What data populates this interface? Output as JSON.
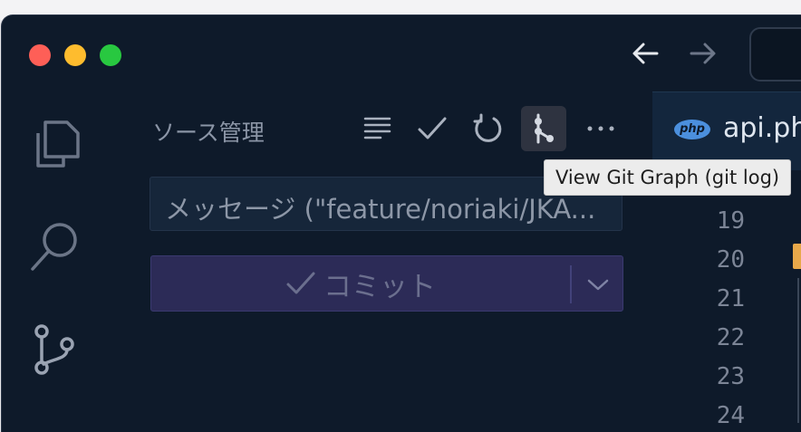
{
  "window": {
    "traffic_lights": [
      "close",
      "minimize",
      "zoom"
    ]
  },
  "nav": {
    "back_icon": "arrow-left-icon",
    "forward_icon": "arrow-right-icon"
  },
  "activity_bar": {
    "items": [
      {
        "name": "explorer",
        "icon": "files-icon"
      },
      {
        "name": "search",
        "icon": "search-icon"
      },
      {
        "name": "source-control",
        "icon": "source-control-icon"
      }
    ]
  },
  "scm": {
    "title": "ソース管理",
    "toolbar_icons": [
      "view-as-tree-icon",
      "commit-check-icon",
      "refresh-icon",
      "git-graph-icon",
      "more-icon"
    ],
    "message_placeholder": "メッセージ (\"feature/noriaki/JKA...",
    "commit_label": "コミット"
  },
  "tooltip": {
    "text": "View Git Graph (git log)"
  },
  "editor": {
    "tab_badge": "php",
    "tab_label": "api.ph",
    "line_numbers": [
      "19",
      "20",
      "21",
      "22",
      "23",
      "24"
    ]
  },
  "colors": {
    "background": "#0e1a2a",
    "commit_button": "#2c2b57",
    "php_badge": "#4b8fdd"
  }
}
